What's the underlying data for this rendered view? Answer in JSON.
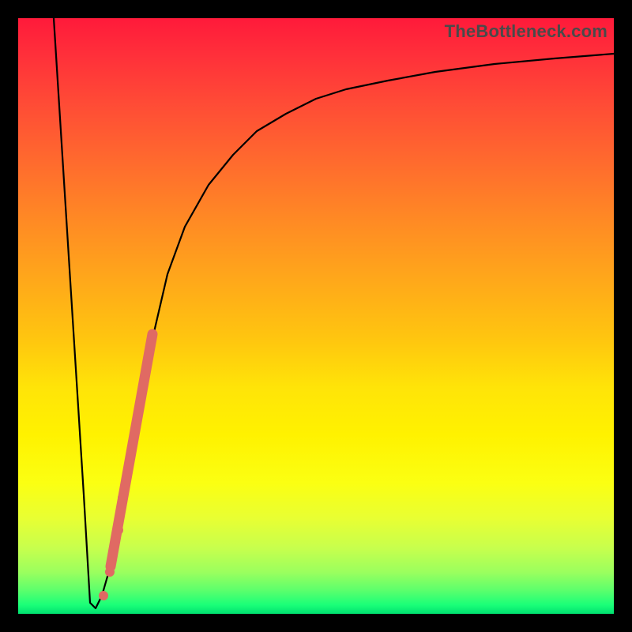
{
  "watermark": "TheBottleneck.com",
  "colors": {
    "frame": "#000000",
    "curve": "#000000",
    "cluster": "#e06a63",
    "gradient_top": "#ff1a3a",
    "gradient_bottom": "#00e070"
  },
  "chart_data": {
    "type": "line",
    "title": "",
    "xlabel": "",
    "ylabel": "",
    "xlim": [
      0,
      100
    ],
    "ylim": [
      0,
      100
    ],
    "grid": false,
    "legend": false,
    "series": [
      {
        "name": "bottleneck-curve",
        "x": [
          6,
          8,
          10,
          11,
          12,
          13,
          14,
          16,
          18,
          20,
          22,
          25,
          28,
          32,
          36,
          40,
          45,
          50,
          55,
          62,
          70,
          80,
          90,
          100
        ],
        "y": [
          100,
          60,
          20,
          4,
          1,
          1,
          3,
          10,
          22,
          34,
          45,
          57,
          65,
          72,
          77,
          81,
          84,
          86.5,
          88,
          89.5,
          91,
          92.3,
          93.2,
          94
        ]
      }
    ],
    "cluster": {
      "name": "highlighted-range",
      "segment": {
        "x": [
          15.5,
          22.5
        ],
        "y": [
          8,
          47
        ]
      },
      "dots": [
        {
          "x": 14.3,
          "y": 3.0,
          "r": 6
        },
        {
          "x": 15.4,
          "y": 7.0,
          "r": 6
        },
        {
          "x": 16.8,
          "y": 14.0,
          "r": 6
        },
        {
          "x": 17.5,
          "y": 19.5,
          "r": 6
        }
      ]
    },
    "background": {
      "type": "vertical-gradient",
      "meaning": "red-high-to-green-low"
    }
  }
}
